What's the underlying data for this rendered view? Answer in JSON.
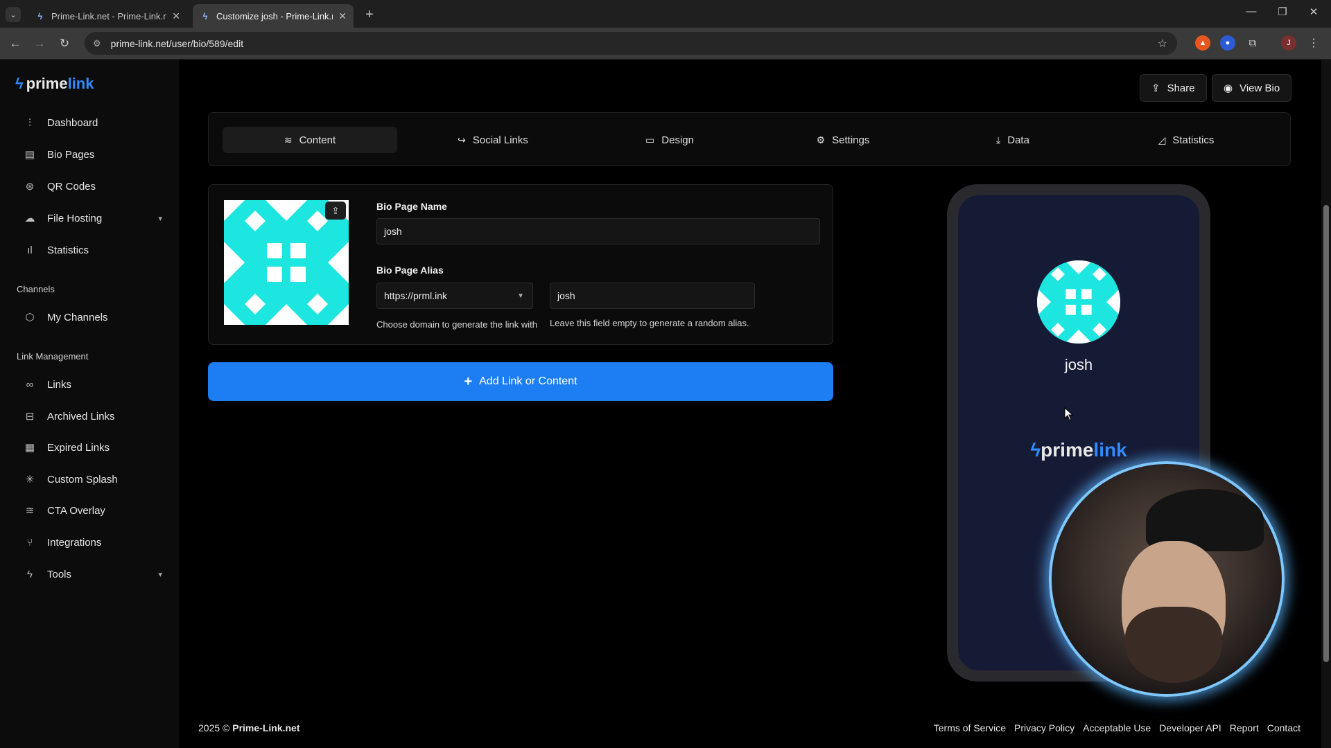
{
  "browser": {
    "tabs": [
      {
        "title": "Prime-Link.net - Prime-Link.net",
        "active": false
      },
      {
        "title": "Customize josh - Prime-Link.ne",
        "active": true
      }
    ],
    "url": "prime-link.net/user/bio/589/edit",
    "profile_initial": "J"
  },
  "brand": {
    "part1": "prime",
    "part2": "link",
    "accent": "#2f8bff"
  },
  "sidebar": {
    "items": [
      {
        "label": "Dashboard",
        "icon": "sliders-icon"
      },
      {
        "label": "Bio Pages",
        "icon": "layout-icon"
      },
      {
        "label": "QR Codes",
        "icon": "qr-icon"
      },
      {
        "label": "File Hosting",
        "icon": "cloud-upload-icon"
      },
      {
        "label": "Statistics",
        "icon": "bar-chart-icon"
      }
    ],
    "channels_label": "Channels",
    "channels_items": [
      {
        "label": "My Channels",
        "icon": "cube-icon"
      }
    ],
    "link_mgmt_label": "Link Management",
    "link_items": [
      {
        "label": "Links",
        "icon": "link-icon"
      },
      {
        "label": "Archived Links",
        "icon": "archive-icon"
      },
      {
        "label": "Expired Links",
        "icon": "calendar-icon"
      },
      {
        "label": "Custom Splash",
        "icon": "loader-icon"
      },
      {
        "label": "CTA Overlay",
        "icon": "layers-icon"
      },
      {
        "label": "Integrations",
        "icon": "git-branch-icon"
      },
      {
        "label": "Tools",
        "icon": "bolt-icon"
      }
    ]
  },
  "header": {
    "share_label": "Share",
    "view_bio_label": "View Bio"
  },
  "content_tabs": [
    {
      "label": "Content",
      "icon": "layers-icon",
      "active": true
    },
    {
      "label": "Social Links",
      "icon": "share-arrow-icon",
      "active": false
    },
    {
      "label": "Design",
      "icon": "monitor-icon",
      "active": false
    },
    {
      "label": "Settings",
      "icon": "gears-icon",
      "active": false
    },
    {
      "label": "Data",
      "icon": "download-icon",
      "active": false
    },
    {
      "label": "Statistics",
      "icon": "area-chart-icon",
      "active": false
    }
  ],
  "bio_form": {
    "name_label": "Bio Page Name",
    "name_value": "josh",
    "alias_label": "Bio Page Alias",
    "domain_value": "https://prml.ink",
    "alias_value": "josh",
    "domain_help": "Choose domain to generate the link with",
    "alias_help": "Leave this field empty to generate a random alias."
  },
  "add_button_label": "Add Link or Content",
  "preview": {
    "name": "josh"
  },
  "footer": {
    "year": "2025 ©",
    "site": "Prime-Link.net",
    "links": [
      "Terms of Service",
      "Privacy Policy",
      "Acceptable Use",
      "Developer API",
      "Report",
      "Contact"
    ]
  }
}
